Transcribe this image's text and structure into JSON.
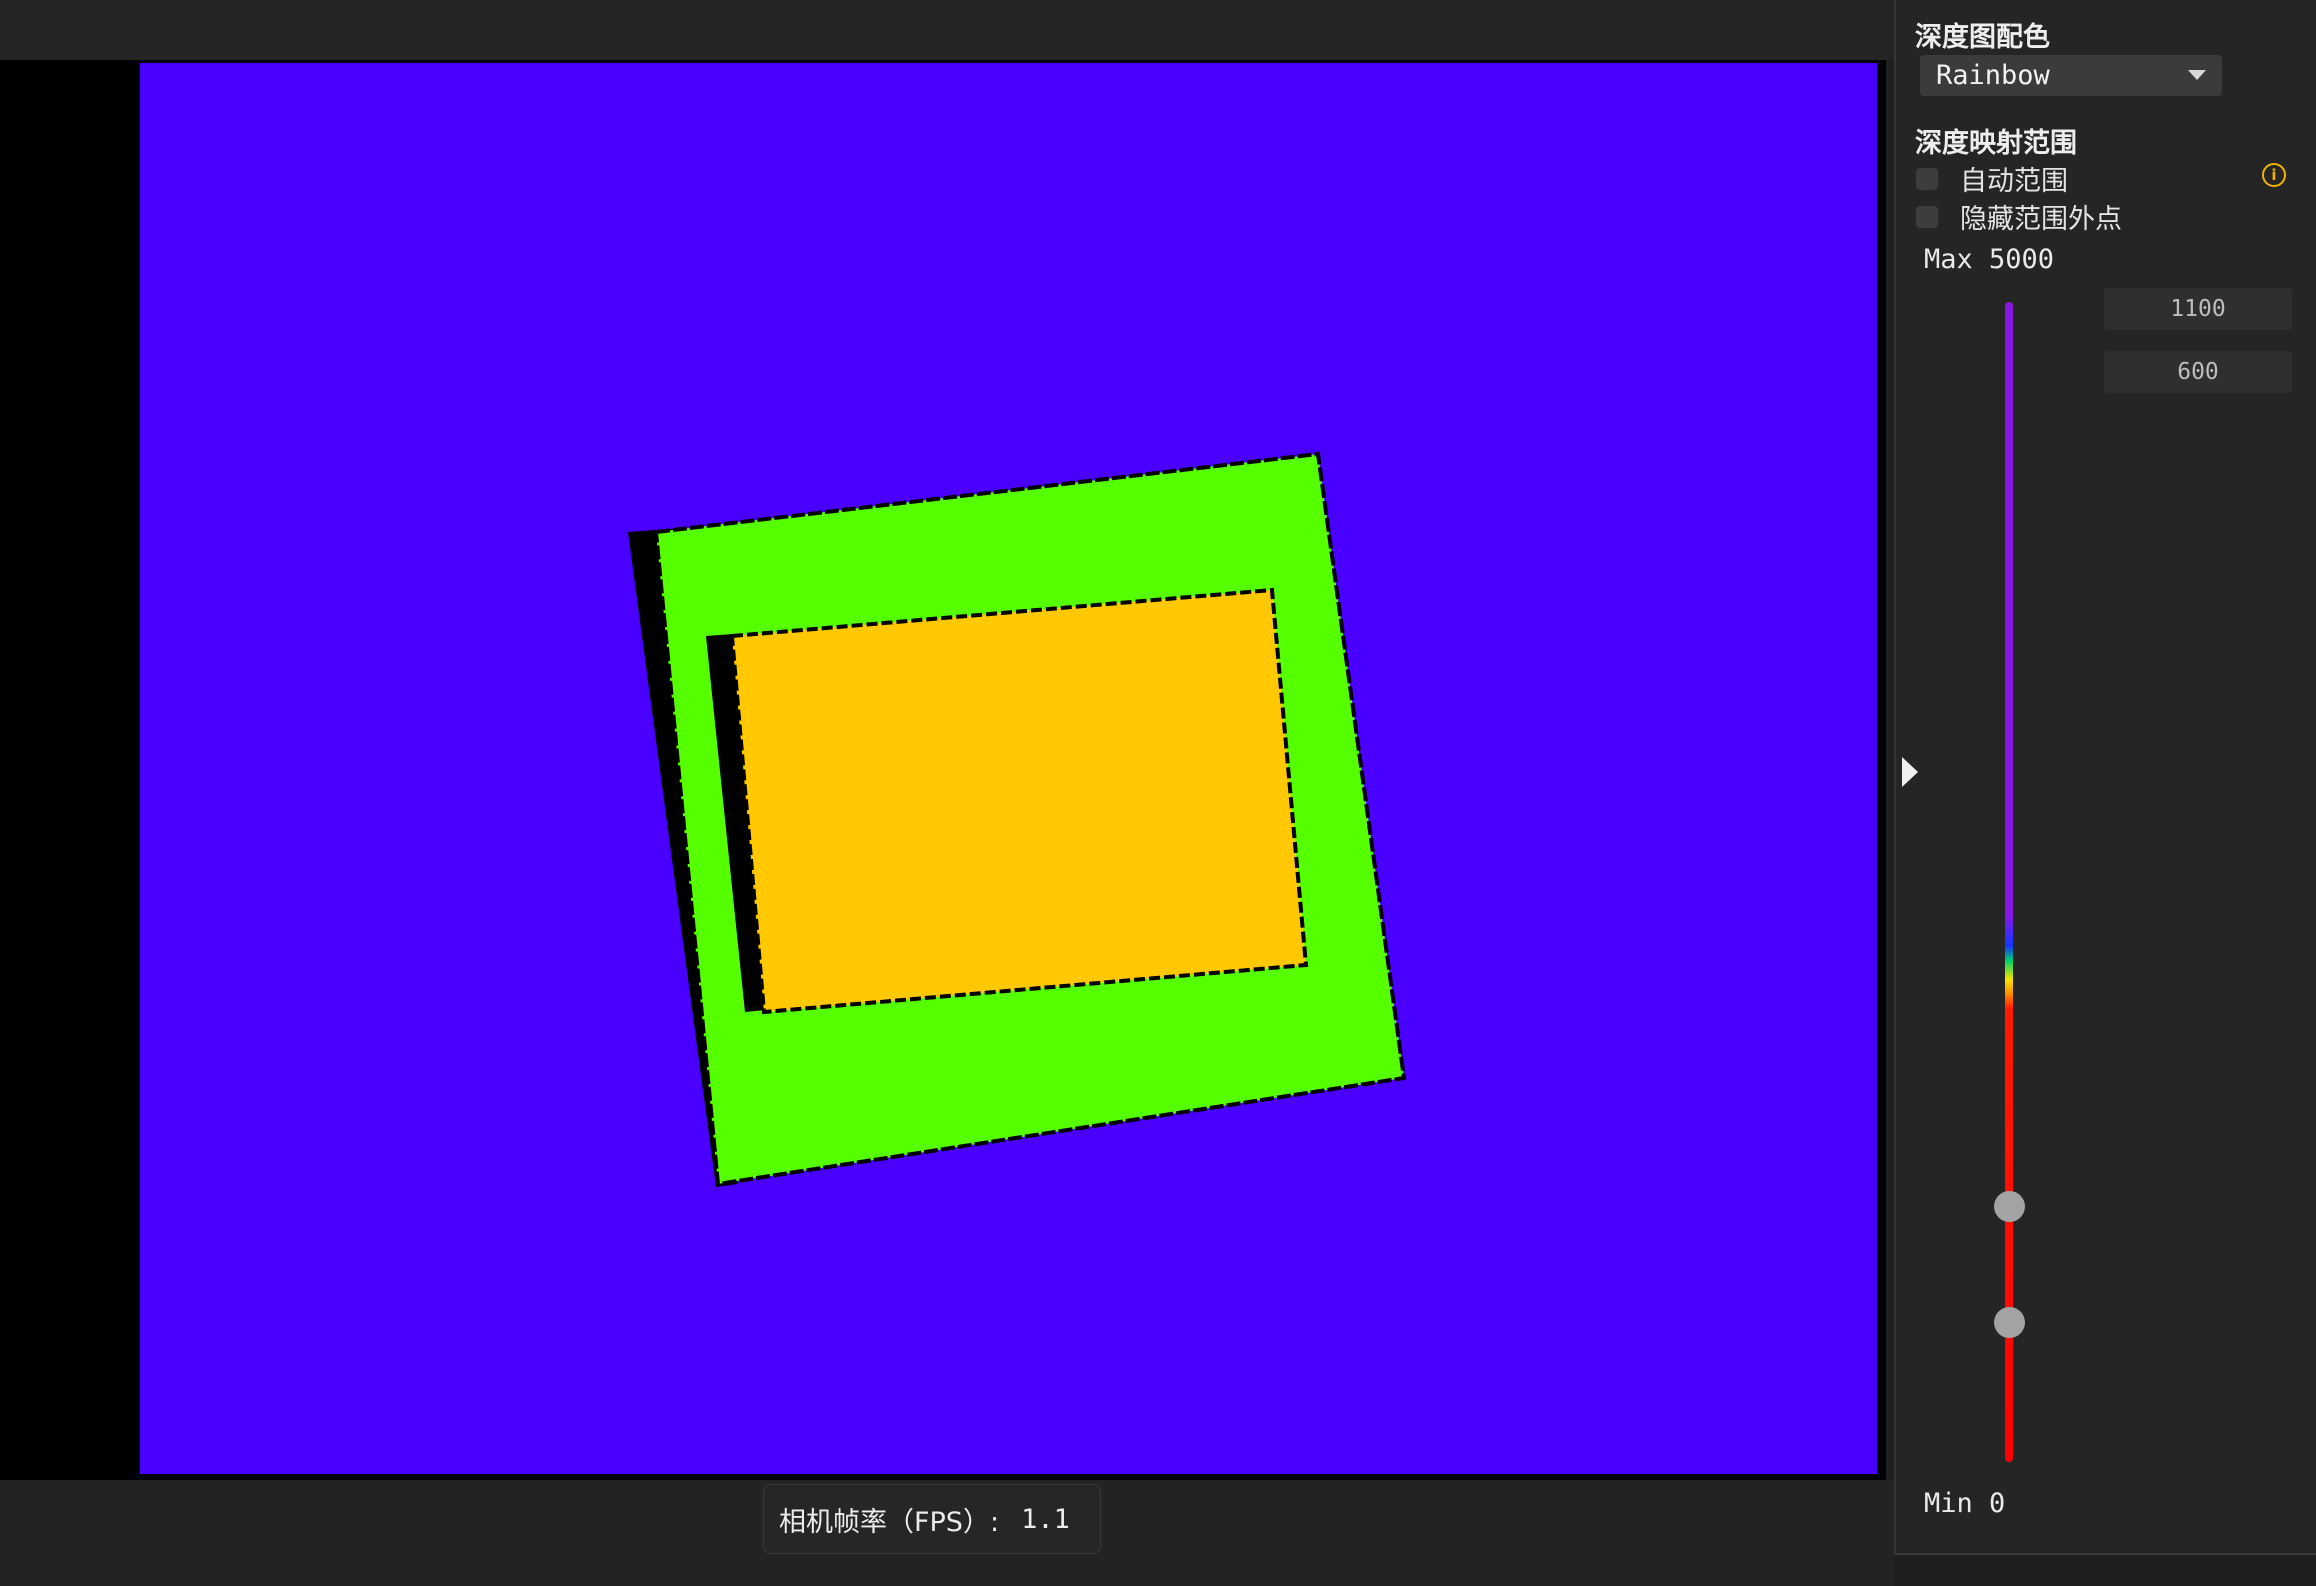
{
  "status_bar": {
    "fps_label": "相机帧率（FPS）:",
    "fps_value": "1.1"
  },
  "panel": {
    "colormap_title": "深度图配色",
    "colormap_selected": "Rainbow",
    "range_title": "深度映射范围",
    "auto_range_label": "自动范围",
    "auto_range_checked": false,
    "hide_outside_label": "隐藏范围外点",
    "hide_outside_checked": false,
    "info_glyph": "i",
    "max_label": "Max 5000",
    "min_label": "Min 0",
    "upper_value": "1100",
    "lower_value": "600",
    "slider_max": 5000,
    "slider_min": 0
  },
  "icons": {
    "dropdown": "chevron-down-icon",
    "info": "info-icon",
    "collapse": "triangle-right-icon"
  },
  "colors": {
    "depth_background": "#4a00ff",
    "depth_frame": "#55ff00",
    "depth_inner": "#ffc800",
    "invalid_depth": "#000000",
    "info_accent": "#f0b400"
  }
}
